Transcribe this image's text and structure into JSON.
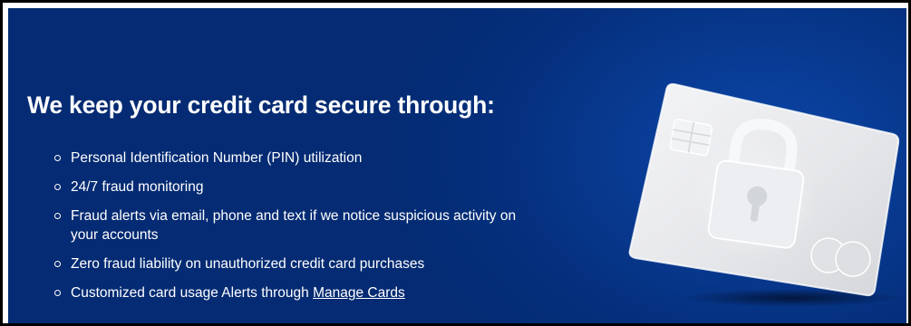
{
  "banner": {
    "headline": "We keep your credit card secure through:",
    "features": [
      "Personal Identification Number (PIN) utilization",
      "24/7 fraud monitoring",
      "Fraud alerts via email, phone and text if we notice suspicious activity on your accounts",
      "Zero fraud liability on unauthorized credit card purchases"
    ],
    "last_feature_prefix": "Customized card usage Alerts through ",
    "manage_cards_link": "Manage Cards"
  },
  "colors": {
    "background": "#052f7c",
    "text": "#ffffff",
    "card": "#e9eaec"
  },
  "illustration": {
    "icons": [
      "credit-card-icon",
      "chip-icon",
      "padlock-icon",
      "card-brand-logo-icon"
    ]
  }
}
